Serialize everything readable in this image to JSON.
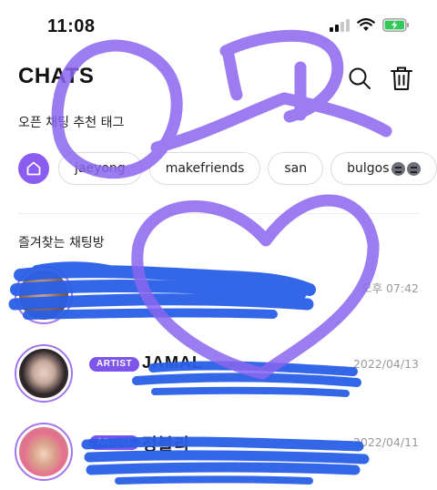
{
  "status_bar": {
    "time": "11:08"
  },
  "header": {
    "title": "CHATS",
    "search_icon": "search-icon",
    "delete_icon": "trash-icon"
  },
  "open_chat": {
    "label": "오픈 채팅 추천 태그",
    "home_icon": "home-icon",
    "tags": [
      "jaeyong",
      "makefriends",
      "san",
      "bulgos"
    ]
  },
  "favorites": {
    "label": "즐겨찾는 채팅방",
    "rows": [
      {
        "time": "오후 07:42"
      },
      {
        "badge": "ARTIST",
        "name": "JAMAL",
        "time": "2022/04/13"
      },
      {
        "badge": "ARTIST",
        "name": "정블리",
        "time": "2022/04/11"
      }
    ]
  },
  "colors": {
    "accent": "#8a5cf0",
    "scribble_purple": "#8b66ee",
    "scribble_blue": "#2a5fe6"
  }
}
